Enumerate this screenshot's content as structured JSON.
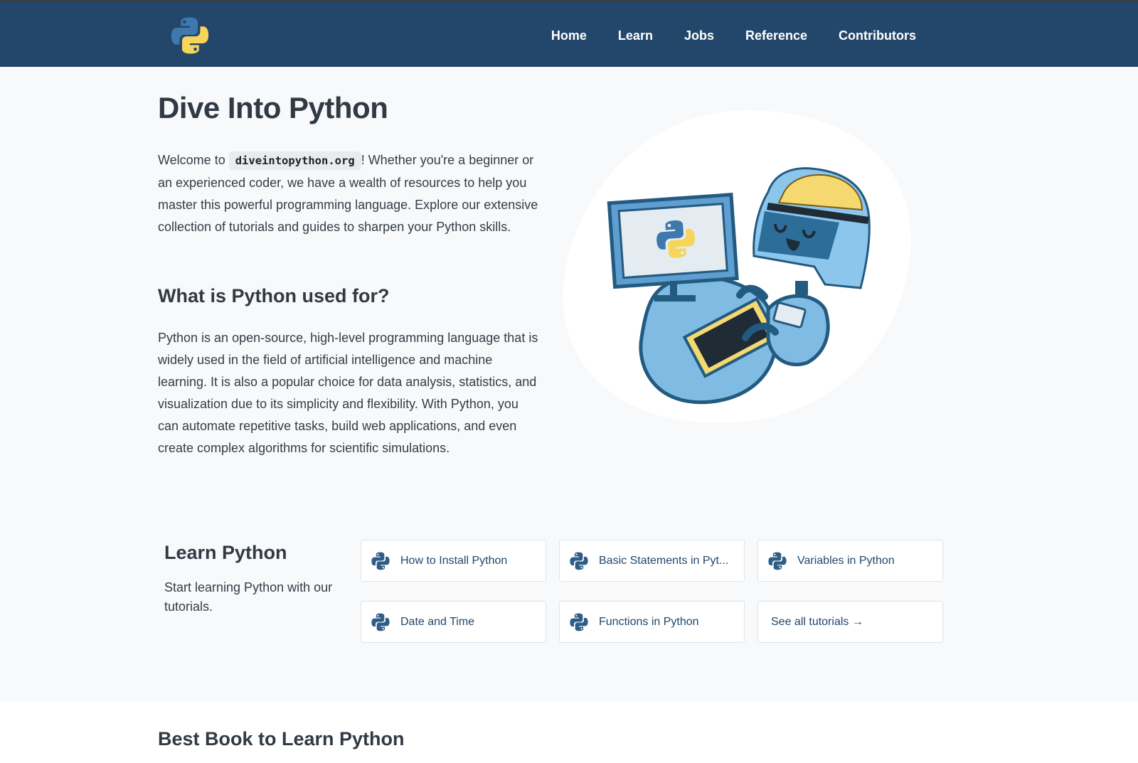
{
  "nav": {
    "logo_icon": "python-logo-icon",
    "links": [
      "Home",
      "Learn",
      "Jobs",
      "Reference",
      "Contributors"
    ]
  },
  "hero": {
    "title": "Dive Into Python",
    "intro_prefix": "Welcome to ",
    "intro_code": "diveintopython.org",
    "intro_suffix": "! Whether you're a beginner or an experienced coder, we have a wealth of resources to help you master this powerful programming language. Explore our extensive collection of tutorials and guides to sharpen your Python skills.",
    "used_heading": "What is Python used for?",
    "used_text": "Python is an open-source, high-level programming language that is widely used in the field of artificial intelligence and machine learning. It is also a popular choice for data analysis, statistics, and visualization due to its simplicity and flexibility. With Python, you can automate repetitive tasks, build web applications, and even create complex algorithms for scientific simulations."
  },
  "learn": {
    "heading": "Learn Python",
    "description": "Start learning Python with our tutorials.",
    "tiles": [
      {
        "label": "How to Install Python",
        "icon": "python-icon"
      },
      {
        "label": "Basic Statements in Pyt...",
        "icon": "python-icon"
      },
      {
        "label": "Variables in Python",
        "icon": "python-icon"
      },
      {
        "label": "Date and Time",
        "icon": "python-icon"
      },
      {
        "label": "Functions in Python",
        "icon": "python-icon"
      },
      {
        "label": "See all tutorials →",
        "icon": ""
      }
    ]
  },
  "book": {
    "heading": "Best Book to Learn Python"
  },
  "colors": {
    "nav_bg": "#22476b",
    "page_bg": "#f8f9fa",
    "link": "#22476b",
    "python_blue": "#2f5d87",
    "python_yellow": "#f7d45a"
  }
}
